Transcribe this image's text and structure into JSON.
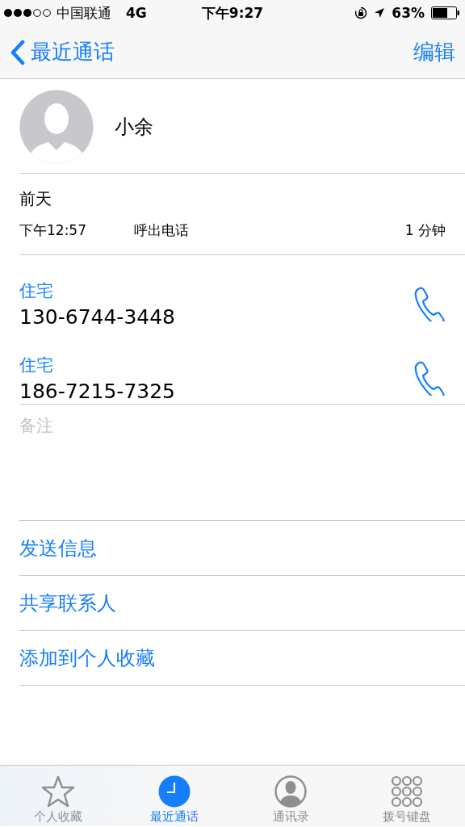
{
  "status_bar": {
    "carrier": "中国联通",
    "network": "4G",
    "time": "下午9:27",
    "battery": "63%"
  },
  "nav": {
    "back": "最近通话",
    "action": "编辑"
  },
  "contact": {
    "name": "小余"
  },
  "recent_call": {
    "day": "前天",
    "time": "下午12:57",
    "type": "呼出电话",
    "duration": "1 分钟"
  },
  "phones": [
    {
      "label": "住宅",
      "number": "130-6744-3448"
    },
    {
      "label": "住宅",
      "number": "186-7215-7325"
    }
  ],
  "notes": {
    "placeholder": "备注"
  },
  "actions": [
    "发送信息",
    "共享联系人",
    "添加到个人收藏"
  ],
  "tabs": [
    {
      "label": "个人收藏",
      "kind": "star",
      "selected": false
    },
    {
      "label": "最近通话",
      "kind": "clock",
      "selected": true
    },
    {
      "label": "通讯录",
      "kind": "person",
      "selected": false
    },
    {
      "label": "拨号键盘",
      "kind": "keypad",
      "selected": false
    }
  ]
}
